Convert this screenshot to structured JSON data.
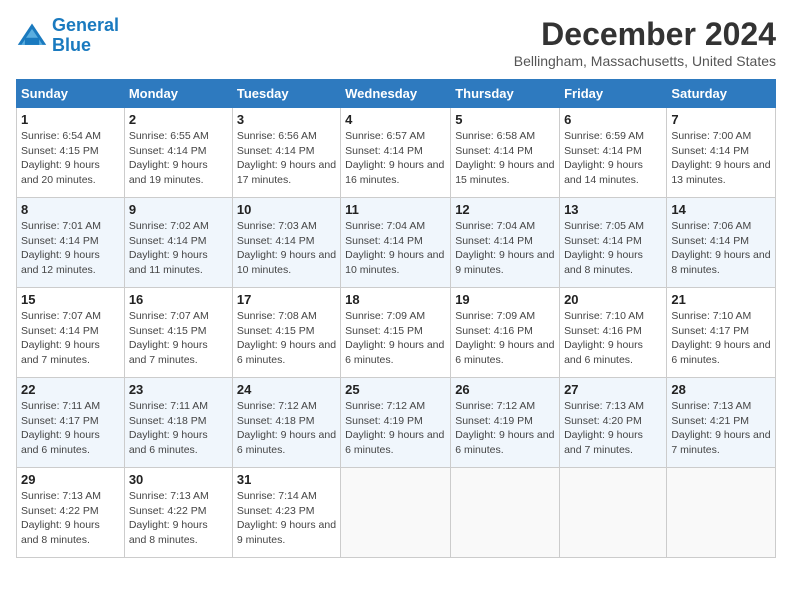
{
  "logo": {
    "line1": "General",
    "line2": "Blue"
  },
  "title": "December 2024",
  "location": "Bellingham, Massachusetts, United States",
  "days_of_week": [
    "Sunday",
    "Monday",
    "Tuesday",
    "Wednesday",
    "Thursday",
    "Friday",
    "Saturday"
  ],
  "weeks": [
    [
      {
        "num": "1",
        "sunrise": "6:54 AM",
        "sunset": "4:15 PM",
        "daylight": "9 hours and 20 minutes."
      },
      {
        "num": "2",
        "sunrise": "6:55 AM",
        "sunset": "4:14 PM",
        "daylight": "9 hours and 19 minutes."
      },
      {
        "num": "3",
        "sunrise": "6:56 AM",
        "sunset": "4:14 PM",
        "daylight": "9 hours and 17 minutes."
      },
      {
        "num": "4",
        "sunrise": "6:57 AM",
        "sunset": "4:14 PM",
        "daylight": "9 hours and 16 minutes."
      },
      {
        "num": "5",
        "sunrise": "6:58 AM",
        "sunset": "4:14 PM",
        "daylight": "9 hours and 15 minutes."
      },
      {
        "num": "6",
        "sunrise": "6:59 AM",
        "sunset": "4:14 PM",
        "daylight": "9 hours and 14 minutes."
      },
      {
        "num": "7",
        "sunrise": "7:00 AM",
        "sunset": "4:14 PM",
        "daylight": "9 hours and 13 minutes."
      }
    ],
    [
      {
        "num": "8",
        "sunrise": "7:01 AM",
        "sunset": "4:14 PM",
        "daylight": "9 hours and 12 minutes."
      },
      {
        "num": "9",
        "sunrise": "7:02 AM",
        "sunset": "4:14 PM",
        "daylight": "9 hours and 11 minutes."
      },
      {
        "num": "10",
        "sunrise": "7:03 AM",
        "sunset": "4:14 PM",
        "daylight": "9 hours and 10 minutes."
      },
      {
        "num": "11",
        "sunrise": "7:04 AM",
        "sunset": "4:14 PM",
        "daylight": "9 hours and 10 minutes."
      },
      {
        "num": "12",
        "sunrise": "7:04 AM",
        "sunset": "4:14 PM",
        "daylight": "9 hours and 9 minutes."
      },
      {
        "num": "13",
        "sunrise": "7:05 AM",
        "sunset": "4:14 PM",
        "daylight": "9 hours and 8 minutes."
      },
      {
        "num": "14",
        "sunrise": "7:06 AM",
        "sunset": "4:14 PM",
        "daylight": "9 hours and 8 minutes."
      }
    ],
    [
      {
        "num": "15",
        "sunrise": "7:07 AM",
        "sunset": "4:14 PM",
        "daylight": "9 hours and 7 minutes."
      },
      {
        "num": "16",
        "sunrise": "7:07 AM",
        "sunset": "4:15 PM",
        "daylight": "9 hours and 7 minutes."
      },
      {
        "num": "17",
        "sunrise": "7:08 AM",
        "sunset": "4:15 PM",
        "daylight": "9 hours and 6 minutes."
      },
      {
        "num": "18",
        "sunrise": "7:09 AM",
        "sunset": "4:15 PM",
        "daylight": "9 hours and 6 minutes."
      },
      {
        "num": "19",
        "sunrise": "7:09 AM",
        "sunset": "4:16 PM",
        "daylight": "9 hours and 6 minutes."
      },
      {
        "num": "20",
        "sunrise": "7:10 AM",
        "sunset": "4:16 PM",
        "daylight": "9 hours and 6 minutes."
      },
      {
        "num": "21",
        "sunrise": "7:10 AM",
        "sunset": "4:17 PM",
        "daylight": "9 hours and 6 minutes."
      }
    ],
    [
      {
        "num": "22",
        "sunrise": "7:11 AM",
        "sunset": "4:17 PM",
        "daylight": "9 hours and 6 minutes."
      },
      {
        "num": "23",
        "sunrise": "7:11 AM",
        "sunset": "4:18 PM",
        "daylight": "9 hours and 6 minutes."
      },
      {
        "num": "24",
        "sunrise": "7:12 AM",
        "sunset": "4:18 PM",
        "daylight": "9 hours and 6 minutes."
      },
      {
        "num": "25",
        "sunrise": "7:12 AM",
        "sunset": "4:19 PM",
        "daylight": "9 hours and 6 minutes."
      },
      {
        "num": "26",
        "sunrise": "7:12 AM",
        "sunset": "4:19 PM",
        "daylight": "9 hours and 6 minutes."
      },
      {
        "num": "27",
        "sunrise": "7:13 AM",
        "sunset": "4:20 PM",
        "daylight": "9 hours and 7 minutes."
      },
      {
        "num": "28",
        "sunrise": "7:13 AM",
        "sunset": "4:21 PM",
        "daylight": "9 hours and 7 minutes."
      }
    ],
    [
      {
        "num": "29",
        "sunrise": "7:13 AM",
        "sunset": "4:22 PM",
        "daylight": "9 hours and 8 minutes."
      },
      {
        "num": "30",
        "sunrise": "7:13 AM",
        "sunset": "4:22 PM",
        "daylight": "9 hours and 8 minutes."
      },
      {
        "num": "31",
        "sunrise": "7:14 AM",
        "sunset": "4:23 PM",
        "daylight": "9 hours and 9 minutes."
      },
      null,
      null,
      null,
      null
    ]
  ],
  "labels": {
    "sunrise": "Sunrise:",
    "sunset": "Sunset:",
    "daylight": "Daylight:"
  }
}
